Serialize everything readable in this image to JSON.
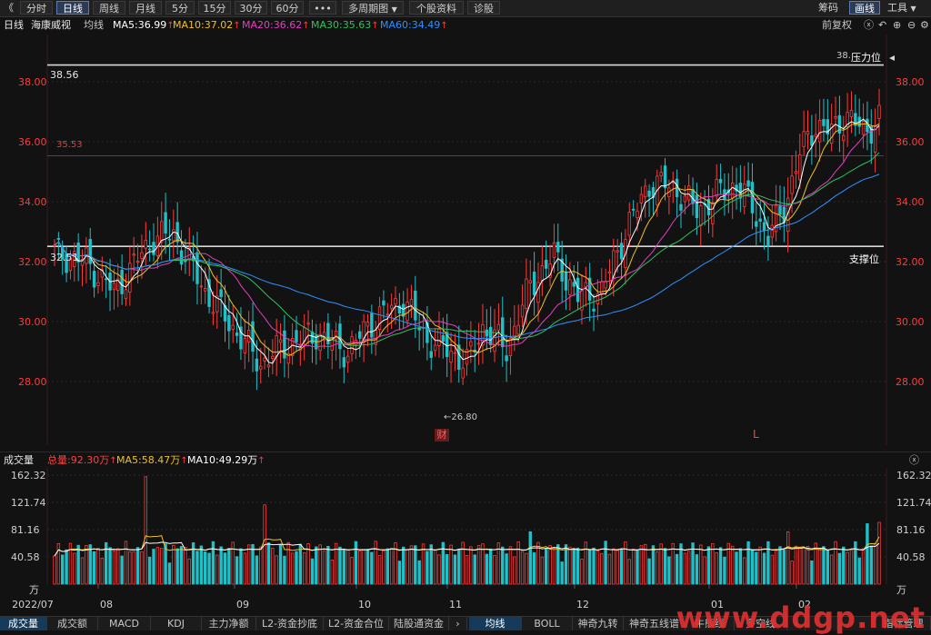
{
  "toolbar": {
    "back_icon": "double-chevron-left-icon",
    "periods": [
      "分时",
      "日线",
      "周线",
      "月线",
      "5分",
      "15分",
      "30分",
      "60分"
    ],
    "active_period": "日线",
    "more_label": "•••",
    "multi_period": "多周期图",
    "stock_info": "个股资料",
    "diagnose": "诊股",
    "chips": "筹码",
    "draw": "画线",
    "tools": "工具"
  },
  "ma_header": {
    "period": "日线",
    "stock_name": "海康威视",
    "line_type": "均线",
    "ma5": "MA5:36.99",
    "ma10": "MA10:37.02",
    "ma20": "MA20:36.62",
    "ma30": "MA30:35.63",
    "ma60": "MA60:34.49",
    "adjust": "前复权"
  },
  "colors": {
    "ma5": "#ffffff",
    "ma10": "#f0c020",
    "ma20": "#e040c0",
    "ma30": "#30c060",
    "ma60": "#3090ff",
    "up": "#ff3b3b",
    "down": "#20c0c8"
  },
  "price_panel": {
    "y_ticks": [
      "38.00",
      "36.00",
      "34.00",
      "32.00",
      "30.00",
      "28.00"
    ],
    "resistance_price": "38.56",
    "resistance_right": "38.",
    "resistance_label": "压力位",
    "support_price": "32.51",
    "support_label": "支撑位",
    "midline_price": "35.53",
    "low_marker": "26.80",
    "event_financial": "财",
    "event_l": "L"
  },
  "volume_header": {
    "title": "成交量",
    "total": "总量:92.30万",
    "ma5": "MA5:58.47万",
    "ma10": "MA10:49.29万"
  },
  "volume_panel": {
    "y_ticks": [
      "162.32",
      "121.74",
      "81.16",
      "40.58"
    ],
    "unit": "万",
    "x_labels": [
      "2022/07",
      "08",
      "09",
      "10",
      "11",
      "12",
      "01",
      "02"
    ]
  },
  "bottom_tabs": {
    "left": [
      "成交量",
      "成交额",
      "MACD",
      "KDJ",
      "主力净额",
      "L2-资金抄底",
      "L2-资金合位",
      "陆股通资金"
    ],
    "active_left": "成交量",
    "right": [
      "均线",
      "BOLL",
      "神奇九转",
      "神奇五线谱",
      "牛熊线",
      "多空线"
    ],
    "active_right": "均线",
    "manage": "指标管理"
  },
  "watermark": "www.ddgp.net"
}
